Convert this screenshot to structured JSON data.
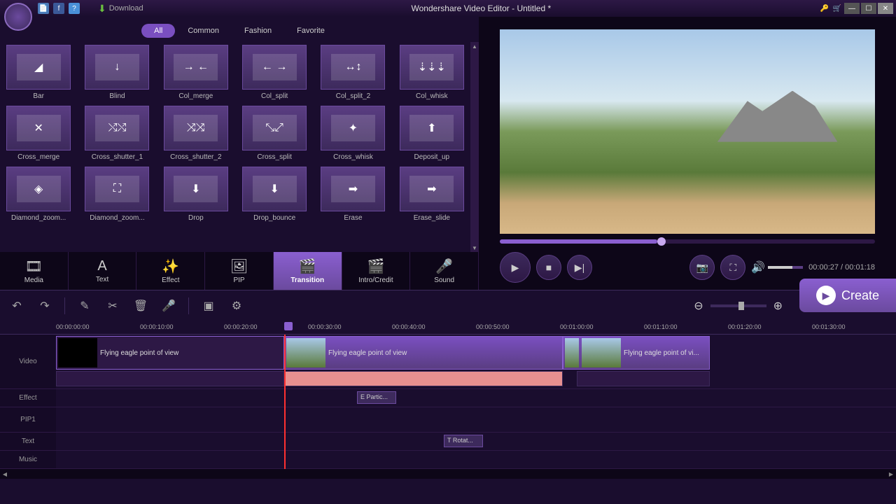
{
  "app": {
    "title": "Wondershare Video Editor - Untitled *",
    "download": "Download"
  },
  "filters": [
    "All",
    "Common",
    "Fashion",
    "Favorite"
  ],
  "activeFilter": 0,
  "transitions": [
    {
      "name": "Bar",
      "glyph": "◢"
    },
    {
      "name": "Blind",
      "glyph": "↓"
    },
    {
      "name": "Col_merge",
      "glyph": "→ ←"
    },
    {
      "name": "Col_split",
      "glyph": "← →"
    },
    {
      "name": "Col_split_2",
      "glyph": "↔↕"
    },
    {
      "name": "Col_whisk",
      "glyph": "⇣⇣⇣"
    },
    {
      "name": "Cross_merge",
      "glyph": "✕"
    },
    {
      "name": "Cross_shutter_1",
      "glyph": "⤭⤭"
    },
    {
      "name": "Cross_shutter_2",
      "glyph": "⤨⤨"
    },
    {
      "name": "Cross_split",
      "glyph": "⤡⤢"
    },
    {
      "name": "Cross_whisk",
      "glyph": "✦"
    },
    {
      "name": "Deposit_up",
      "glyph": "⬆"
    },
    {
      "name": "Diamond_zoom...",
      "glyph": "◈"
    },
    {
      "name": "Diamond_zoom...",
      "glyph": "⛶"
    },
    {
      "name": "Drop",
      "glyph": "⬇"
    },
    {
      "name": "Drop_bounce",
      "glyph": "⬇"
    },
    {
      "name": "Erase",
      "glyph": "➡"
    },
    {
      "name": "Erase_slide",
      "glyph": "➡"
    }
  ],
  "modules": [
    {
      "name": "Media",
      "icon": "🎞"
    },
    {
      "name": "Text",
      "icon": "A"
    },
    {
      "name": "Effect",
      "icon": "✨"
    },
    {
      "name": "PIP",
      "icon": "🖼"
    },
    {
      "name": "Transition",
      "icon": "🎬"
    },
    {
      "name": "Intro/Credit",
      "icon": "🎬"
    },
    {
      "name": "Sound",
      "icon": "🎤"
    }
  ],
  "activeModule": 4,
  "preview": {
    "currentTime": "00:00:27",
    "totalTime": "00:01:18"
  },
  "create": "Create",
  "ruler": [
    "00:00:00:00",
    "00:00:10:00",
    "00:00:20:00",
    "00:00:30:00",
    "00:00:40:00",
    "00:00:50:00",
    "00:01:00:00",
    "00:01:10:00",
    "00:01:20:00",
    "00:01:30:00"
  ],
  "tracks": {
    "video": "Video",
    "effect": "Effect",
    "pip": "PIP1",
    "text": "Text",
    "music": "Music"
  },
  "clips": {
    "clip1": "Flying eagle point of view",
    "clip2": "Flying eagle point of view",
    "clip3": "Flying eagle point of vi...",
    "effect": "E Partic...",
    "text": "T Rotat..."
  }
}
